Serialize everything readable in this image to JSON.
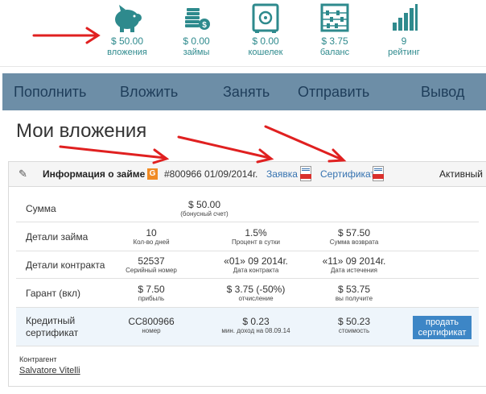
{
  "stats": [
    {
      "value": "$ 50.00",
      "label": "вложения",
      "icon": "piggy-bank-icon"
    },
    {
      "value": "$ 0.00",
      "label": "займы",
      "icon": "coins-icon"
    },
    {
      "value": "$ 0.00",
      "label": "кошелек",
      "icon": "safe-icon"
    },
    {
      "value": "$ 3.75",
      "label": "баланс",
      "icon": "abacus-icon"
    },
    {
      "value": "9",
      "label": "рейтинг",
      "icon": "bar-chart-icon"
    }
  ],
  "nav": [
    "Пополнить",
    "Вложить",
    "Занять",
    "Отправить",
    "Вывод"
  ],
  "page_title": "Мои вложения",
  "loan": {
    "info_label": "Информация о займе",
    "badge": "G",
    "number": "#800966 01/09/2014г.",
    "request_link": "Заявка",
    "certificate_link": "Сертификат",
    "status": "Активный"
  },
  "rows": [
    {
      "label": "Сумма",
      "cells": [
        {
          "value": "$ 50.00",
          "sub": "(бонусный счет)"
        }
      ]
    },
    {
      "label": "Детали займа",
      "cells": [
        {
          "value": "10",
          "sub": "Кол-во дней"
        },
        {
          "value": "1.5%",
          "sub": "Процент в сутки"
        },
        {
          "value": "$ 57.50",
          "sub": "Сумма возврата"
        }
      ]
    },
    {
      "label": "Детали контракта",
      "cells": [
        {
          "value": "52537",
          "sub": "Серийный номер"
        },
        {
          "value": "«01» 09 2014г.",
          "sub": "Дата контракта"
        },
        {
          "value": "«11» 09 2014г.",
          "sub": "Дата истечения"
        }
      ]
    },
    {
      "label": "Гарант (вкл)",
      "cells": [
        {
          "value": "$ 7.50",
          "sub": "прибыль"
        },
        {
          "value": "$ 3.75 (-50%)",
          "sub": "отчисление"
        },
        {
          "value": "$ 53.75",
          "sub": "вы получите"
        }
      ]
    },
    {
      "label_line1": "Кредитный",
      "label_line2": "сертификат",
      "cells": [
        {
          "value": "CC800966",
          "sub": "номер"
        },
        {
          "value": "$ 0.23",
          "sub": "мин. доход на 08.09.14"
        },
        {
          "value": "$ 50.23",
          "sub": "стоимость"
        }
      ],
      "button_line1": "продать",
      "button_line2": "сертификат"
    }
  ],
  "counterparty": {
    "label": "Контрагент",
    "name": "Salvatore Vitelli"
  },
  "colors": {
    "accent": "#2e8a8d",
    "nav_bg": "#6d8ea7",
    "nav_text": "#1e3d5a",
    "link": "#3572b0",
    "button": "#3d86c6",
    "annotation": "#e02020",
    "badge": "#f08a24"
  }
}
